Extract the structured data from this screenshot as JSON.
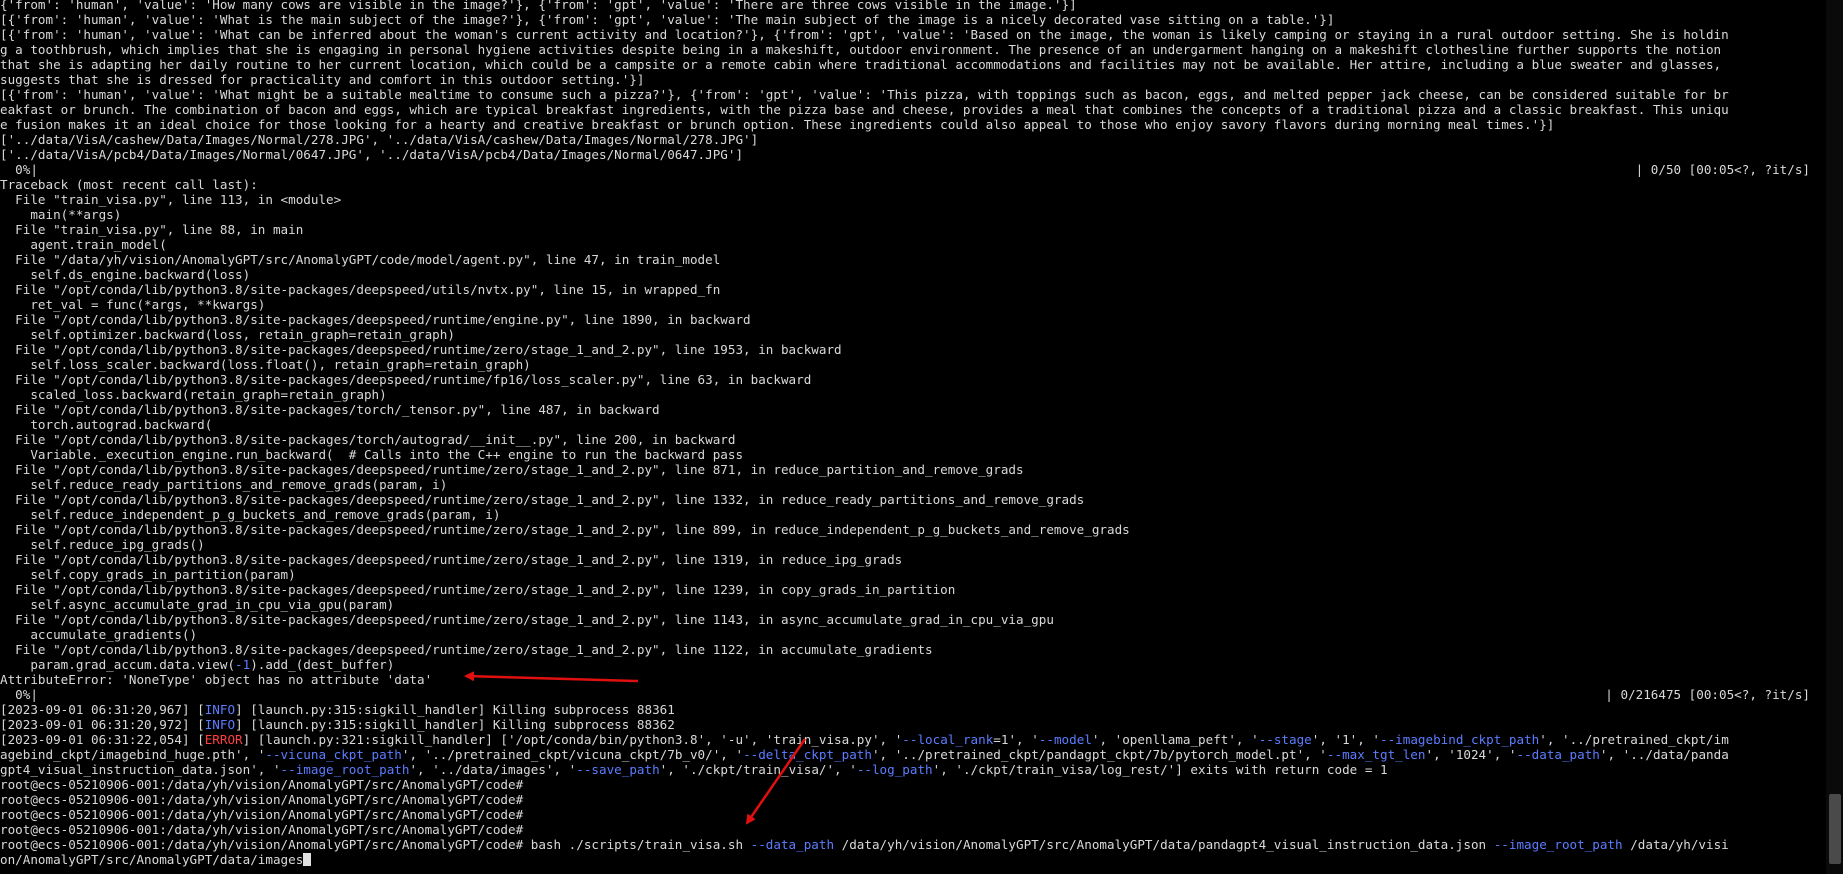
{
  "terminal": {
    "lines": [
      [
        {
          "t": "{'from': 'human', 'value': 'How many cows are visible in the image?'}, {'from': 'gpt', 'value': 'There are three cows visible in the image.'}]",
          "c": "d"
        }
      ],
      [
        {
          "t": "[{'from': 'human', 'value': 'What is the main subject of the image?'}, {'from': 'gpt', 'value': 'The main subject of the image is a nicely decorated vase sitting on a table.'}]",
          "c": "d"
        }
      ],
      [
        {
          "t": "[{'from': 'human', 'value': 'What can be inferred about the woman's current activity and location?'}, {'from': 'gpt', 'value': 'Based on the image, the woman is likely camping or staying in a rural outdoor setting. She is holdin",
          "c": "d"
        }
      ],
      [
        {
          "t": "g a toothbrush, which implies that she is engaging in personal hygiene activities despite being in a makeshift, outdoor environment. The presence of an undergarment hanging on a makeshift clothesline further supports the notion",
          "c": "d"
        }
      ],
      [
        {
          "t": "that she is adapting her daily routine to her current location, which could be a campsite or a remote cabin where traditional accommodations and facilities may not be available. Her attire, including a blue sweater and glasses,",
          "c": "d"
        }
      ],
      [
        {
          "t": "suggests that she is dressed for practicality and comfort in this outdoor setting.'}]",
          "c": "d"
        }
      ],
      [
        {
          "t": "[{'from': 'human', 'value': 'What might be a suitable mealtime to consume such a pizza?'}, {'from': 'gpt', 'value': 'This pizza, with toppings such as bacon, eggs, and melted pepper jack cheese, can be considered suitable for br",
          "c": "d"
        }
      ],
      [
        {
          "t": "eakfast or brunch. The combination of bacon and eggs, which are typical breakfast ingredients, with the pizza base and cheese, provides a meal that combines the concepts of a traditional pizza and a classic breakfast. This uniqu",
          "c": "d"
        }
      ],
      [
        {
          "t": "e fusion makes it an ideal choice for those looking for a hearty and creative breakfast or brunch option. These ingredients could also appeal to those who enjoy savory flavors during morning meal times.'}]",
          "c": "d"
        }
      ],
      [
        {
          "t": "['../data/VisA/cashew/Data/Images/Normal/278.JPG', '../data/VisA/cashew/Data/Images/Normal/278.JPG']",
          "c": "d"
        }
      ],
      [
        {
          "t": "['../data/VisA/pcb4/Data/Images/Normal/0647.JPG', '../data/VisA/pcb4/Data/Images/Normal/0647.JPG']",
          "c": "d"
        }
      ],
      [
        {
          "t": "  0%|",
          "c": "d"
        },
        {
          "t": "| 0/50 [00:05<?, ?it/s]",
          "c": "d",
          "right": true
        }
      ],
      [
        {
          "t": "Traceback (most recent call last):",
          "c": "d"
        }
      ],
      [
        {
          "t": "  File \"train_visa.py\", line 113, in <module>",
          "c": "d"
        }
      ],
      [
        {
          "t": "    main(**args)",
          "c": "d"
        }
      ],
      [
        {
          "t": "  File \"train_visa.py\", line 88, in main",
          "c": "d"
        }
      ],
      [
        {
          "t": "    agent.train_model(",
          "c": "d"
        }
      ],
      [
        {
          "t": "  File \"/data/yh/vision/AnomalyGPT/src/AnomalyGPT/code/model/agent.py\", line 47, in train_model",
          "c": "d"
        }
      ],
      [
        {
          "t": "    self.ds_engine.backward(loss)",
          "c": "d"
        }
      ],
      [
        {
          "t": "  File \"/opt/conda/lib/python3.8/site-packages/deepspeed/utils/nvtx.py\", line 15, in wrapped_fn",
          "c": "d"
        }
      ],
      [
        {
          "t": "    ret_val = func(*args, **kwargs)",
          "c": "d"
        }
      ],
      [
        {
          "t": "  File \"/opt/conda/lib/python3.8/site-packages/deepspeed/runtime/engine.py\", line 1890, in backward",
          "c": "d"
        }
      ],
      [
        {
          "t": "    self.optimizer.backward(loss, retain_graph=retain_graph)",
          "c": "d"
        }
      ],
      [
        {
          "t": "  File \"/opt/conda/lib/python3.8/site-packages/deepspeed/runtime/zero/stage_1_and_2.py\", line 1953, in backward",
          "c": "d"
        }
      ],
      [
        {
          "t": "    self.loss_scaler.backward(loss.float(), retain_graph=retain_graph)",
          "c": "d"
        }
      ],
      [
        {
          "t": "  File \"/opt/conda/lib/python3.8/site-packages/deepspeed/runtime/fp16/loss_scaler.py\", line 63, in backward",
          "c": "d"
        }
      ],
      [
        {
          "t": "    scaled_loss.backward(retain_graph=retain_graph)",
          "c": "d"
        }
      ],
      [
        {
          "t": "  File \"/opt/conda/lib/python3.8/site-packages/torch/_tensor.py\", line 487, in backward",
          "c": "d"
        }
      ],
      [
        {
          "t": "    torch.autograd.backward(",
          "c": "d"
        }
      ],
      [
        {
          "t": "  File \"/opt/conda/lib/python3.8/site-packages/torch/autograd/__init__.py\", line 200, in backward",
          "c": "d"
        }
      ],
      [
        {
          "t": "    Variable._execution_engine.run_backward(  # Calls into the C++ engine to run the backward pass",
          "c": "d"
        }
      ],
      [
        {
          "t": "  File \"/opt/conda/lib/python3.8/site-packages/deepspeed/runtime/zero/stage_1_and_2.py\", line 871, in reduce_partition_and_remove_grads",
          "c": "d"
        }
      ],
      [
        {
          "t": "    self.reduce_ready_partitions_and_remove_grads(param, i)",
          "c": "d"
        }
      ],
      [
        {
          "t": "  File \"/opt/conda/lib/python3.8/site-packages/deepspeed/runtime/zero/stage_1_and_2.py\", line 1332, in reduce_ready_partitions_and_remove_grads",
          "c": "d"
        }
      ],
      [
        {
          "t": "    self.reduce_independent_p_g_buckets_and_remove_grads(param, i)",
          "c": "d"
        }
      ],
      [
        {
          "t": "  File \"/opt/conda/lib/python3.8/site-packages/deepspeed/runtime/zero/stage_1_and_2.py\", line 899, in reduce_independent_p_g_buckets_and_remove_grads",
          "c": "d"
        }
      ],
      [
        {
          "t": "    self.reduce_ipg_grads()",
          "c": "d"
        }
      ],
      [
        {
          "t": "  File \"/opt/conda/lib/python3.8/site-packages/deepspeed/runtime/zero/stage_1_and_2.py\", line 1319, in reduce_ipg_grads",
          "c": "d"
        }
      ],
      [
        {
          "t": "    self.copy_grads_in_partition(param)",
          "c": "d"
        }
      ],
      [
        {
          "t": "  File \"/opt/conda/lib/python3.8/site-packages/deepspeed/runtime/zero/stage_1_and_2.py\", line 1239, in copy_grads_in_partition",
          "c": "d"
        }
      ],
      [
        {
          "t": "    self.async_accumulate_grad_in_cpu_via_gpu(param)",
          "c": "d"
        }
      ],
      [
        {
          "t": "  File \"/opt/conda/lib/python3.8/site-packages/deepspeed/runtime/zero/stage_1_and_2.py\", line 1143, in async_accumulate_grad_in_cpu_via_gpu",
          "c": "d"
        }
      ],
      [
        {
          "t": "    accumulate_gradients()",
          "c": "d"
        }
      ],
      [
        {
          "t": "  File \"/opt/conda/lib/python3.8/site-packages/deepspeed/runtime/zero/stage_1_and_2.py\", line 1122, in accumulate_gradients",
          "c": "d"
        }
      ],
      [
        {
          "t": "    param.grad_accum.data.view(",
          "c": "d"
        },
        {
          "t": "-1",
          "c": "b"
        },
        {
          "t": ").add_(dest_buffer)",
          "c": "d"
        }
      ],
      [
        {
          "t": "AttributeError: 'NoneType' object has no attribute 'data'",
          "c": "d"
        }
      ],
      [
        {
          "t": "  0%|",
          "c": "d"
        },
        {
          "t": "| 0/216475 [00:05<?, ?it/s]",
          "c": "d",
          "right": true
        }
      ],
      [
        {
          "t": "[2023-09-01 06:31:20,967] [",
          "c": "d"
        },
        {
          "t": "INFO",
          "c": "b"
        },
        {
          "t": "] [launch.py:315:sigkill_handler] Killing subprocess 88361",
          "c": "d"
        }
      ],
      [
        {
          "t": "[2023-09-01 06:31:20,972] [",
          "c": "d"
        },
        {
          "t": "INFO",
          "c": "b"
        },
        {
          "t": "] [launch.py:315:sigkill_handler] Killing subprocess 88362",
          "c": "d"
        }
      ],
      [
        {
          "t": "[2023-09-01 06:31:22,054] [",
          "c": "d"
        },
        {
          "t": "ERROR",
          "c": "r"
        },
        {
          "t": "] [launch.py:321:sigkill_handler] ['/opt/conda/bin/python3.8', '-u', 'train_visa.py', '",
          "c": "d"
        },
        {
          "t": "--local_rank",
          "c": "b"
        },
        {
          "t": "=1', '",
          "c": "d"
        },
        {
          "t": "--model",
          "c": "b"
        },
        {
          "t": "', 'openllama_peft', '",
          "c": "d"
        },
        {
          "t": "--stage",
          "c": "b"
        },
        {
          "t": "', '1', '",
          "c": "d"
        },
        {
          "t": "--imagebind_ckpt_path",
          "c": "b"
        },
        {
          "t": "', '../pretrained_ckpt/im",
          "c": "d"
        }
      ],
      [
        {
          "t": "agebind_ckpt/imagebind_huge.pth', '",
          "c": "d"
        },
        {
          "t": "--vicuna_ckpt_path",
          "c": "b"
        },
        {
          "t": "', '../pretrained_ckpt/vicuna_ckpt/7b_v0/', '",
          "c": "d"
        },
        {
          "t": "--delta_ckpt_path",
          "c": "b"
        },
        {
          "t": "', '../pretrained_ckpt/pandagpt_ckpt/7b/pytorch_model.pt', '",
          "c": "d"
        },
        {
          "t": "--max_tgt_len",
          "c": "b"
        },
        {
          "t": "', '1024', '",
          "c": "d"
        },
        {
          "t": "--data_path",
          "c": "b"
        },
        {
          "t": "', '../data/panda",
          "c": "d"
        }
      ],
      [
        {
          "t": "gpt4_visual_instruction_data.json', '",
          "c": "d"
        },
        {
          "t": "--image_root_path",
          "c": "b"
        },
        {
          "t": "', '../data/images', '",
          "c": "d"
        },
        {
          "t": "--save_path",
          "c": "b"
        },
        {
          "t": "', './ckpt/train_visa/', '",
          "c": "d"
        },
        {
          "t": "--log_path",
          "c": "b"
        },
        {
          "t": "', './ckpt/train_visa/log_rest/'] exits with return code = 1",
          "c": "d"
        }
      ],
      [
        {
          "t": "root@ecs-05210906-001:/data/yh/vision/AnomalyGPT/src/AnomalyGPT/code#",
          "c": "d"
        }
      ],
      [
        {
          "t": "root@ecs-05210906-001:/data/yh/vision/AnomalyGPT/src/AnomalyGPT/code#",
          "c": "d"
        }
      ],
      [
        {
          "t": "root@ecs-05210906-001:/data/yh/vision/AnomalyGPT/src/AnomalyGPT/code#",
          "c": "d"
        }
      ],
      [
        {
          "t": "root@ecs-05210906-001:/data/yh/vision/AnomalyGPT/src/AnomalyGPT/code#",
          "c": "d"
        }
      ],
      [
        {
          "t": "root@ecs-05210906-001:/data/yh/vision/AnomalyGPT/src/AnomalyGPT/code# bash ./scripts/train_visa.sh ",
          "c": "d"
        },
        {
          "t": "--data_path",
          "c": "b"
        },
        {
          "t": " /data/yh/vision/AnomalyGPT/src/AnomalyGPT/data/pandagpt4_visual_instruction_data.json ",
          "c": "d"
        },
        {
          "t": "--image_root_path",
          "c": "b"
        },
        {
          "t": " /data/yh/visi",
          "c": "d"
        }
      ],
      [
        {
          "t": "on/AnomalyGPT/src/AnomalyGPT/data/images",
          "c": "d"
        },
        {
          "cursor": true
        }
      ]
    ]
  },
  "colors": {
    "background": "#000000",
    "foreground": "#d9d9d9",
    "option_blue": "#5c7cff",
    "error_red": "#ff4040",
    "annotation_arrow": "#e01010"
  },
  "icons": {
    "cursor": "block-cursor-icon",
    "arrows": "red-arrow-icon"
  }
}
